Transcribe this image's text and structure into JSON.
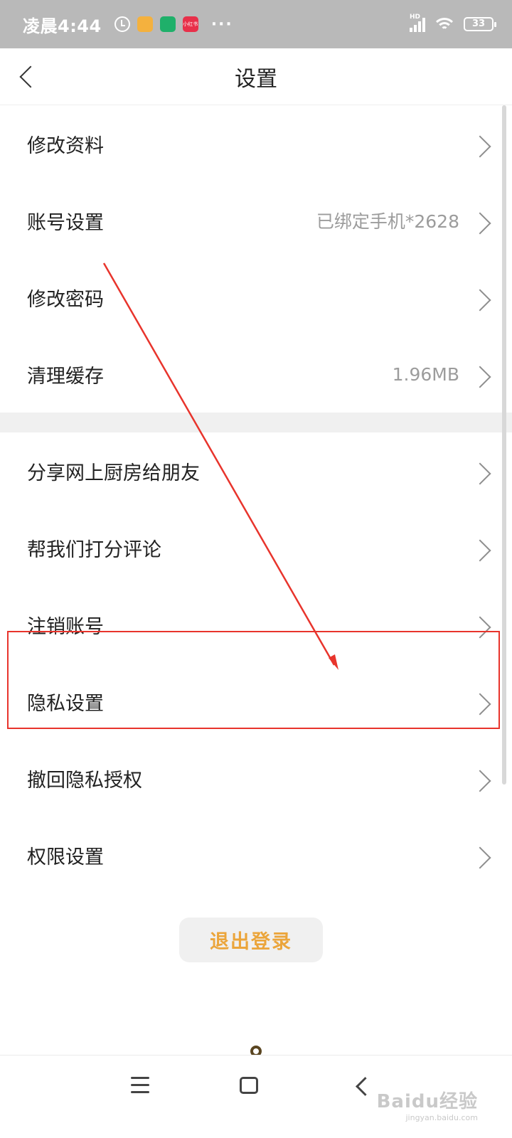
{
  "status_bar": {
    "time": "凌晨4:44",
    "app_icons": [
      "photo-app-icon",
      "shield-app-icon",
      "xiaohongshu-app-icon"
    ],
    "xhs_label": "小红书",
    "more": "···",
    "network": "HD",
    "battery": "33"
  },
  "header": {
    "title": "设置"
  },
  "settings": {
    "group1": [
      {
        "label": "修改资料",
        "value": ""
      },
      {
        "label": "账号设置",
        "value": "已绑定手机*2628"
      },
      {
        "label": "修改密码",
        "value": ""
      },
      {
        "label": "清理缓存",
        "value": "1.96MB"
      }
    ],
    "group2": [
      {
        "label": "分享网上厨房给朋友"
      },
      {
        "label": "帮我们打分评论"
      },
      {
        "label": "注销账号"
      },
      {
        "label": "隐私设置"
      },
      {
        "label": "撤回隐私授权"
      },
      {
        "label": "权限设置"
      }
    ]
  },
  "logout": {
    "label": "退出登录",
    "color": "#eba53b"
  },
  "annotation": {
    "color": "#e8342c",
    "highlighted_item": "隐私设置"
  },
  "watermark": {
    "main": "Baidu经验",
    "sub": "jingyan.baidu.com"
  }
}
